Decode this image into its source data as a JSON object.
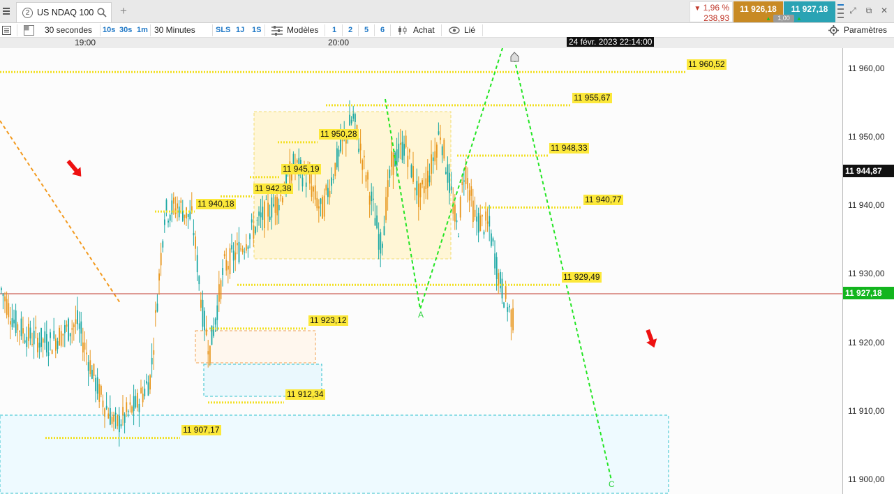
{
  "header": {
    "tab_number": "2",
    "instrument": "US NDAQ 100",
    "change_pct": "1,96 %",
    "change_abs": "238,93",
    "bid": "11 926,18",
    "ask": "11 927,18",
    "spread": "1,00"
  },
  "toolbar": {
    "timeframe_ticks": "30 secondes",
    "btn_10s": "10s",
    "btn_30s": "30s",
    "btn_1m": "1m",
    "timeframe_minutes": "30 Minutes",
    "btn_sls": "SLS",
    "btn_1j": "1J",
    "btn_1s": "1S",
    "models": "Modèles",
    "btn_1": "1",
    "btn_2": "2",
    "btn_5": "5",
    "btn_6": "6",
    "buy": "Achat",
    "linked": "Lié",
    "settings": "Paramètres"
  },
  "time_axis": {
    "labels": [
      "19:00",
      "20:00"
    ],
    "cursor_time": "24 févr. 2023 22:14:00"
  },
  "price_axis": {
    "labels": [
      "11 960,00",
      "11 950,00",
      "11 940,00",
      "11 930,00",
      "11 920,00",
      "11 910,00",
      "11 900,00"
    ],
    "cursor_price": "11 944,87",
    "last_price": "11 927,18"
  },
  "chart_data": {
    "type": "candlestick",
    "instrument": "US NDAQ 100",
    "ylim": [
      11899,
      11964
    ],
    "last_price": 11927.18,
    "cursor_price": 11944.87,
    "levels": [
      {
        "label": "11 960,52",
        "value": 11960.52
      },
      {
        "label": "11 955,67",
        "value": 11955.67
      },
      {
        "label": "11 950,28",
        "value": 11950.28
      },
      {
        "label": "11 948,33",
        "value": 11948.33
      },
      {
        "label": "11 945,19",
        "value": 11945.19
      },
      {
        "label": "11 942,38",
        "value": 11942.38
      },
      {
        "label": "11 940,77",
        "value": 11940.77
      },
      {
        "label": "11 940,18",
        "value": 11940.18
      },
      {
        "label": "11 929,49",
        "value": 11929.49
      },
      {
        "label": "11 923,12",
        "value": 11923.12
      },
      {
        "label": "11 912,34",
        "value": 11912.34
      },
      {
        "label": "11 907,17",
        "value": 11907.17
      }
    ],
    "wave_labels": [
      "A",
      "C"
    ],
    "colors": {
      "bull_candle": "#1ba8a4",
      "bear_candle": "#e8961c",
      "level_line": "#f2df20",
      "level_label_bg": "#fce83a",
      "projection_line": "#22e522",
      "trend_line": "#f39a1e",
      "last_price_line": "#c0392b",
      "last_price_badge": "#13b51e",
      "arrow": "#ee1111"
    }
  }
}
